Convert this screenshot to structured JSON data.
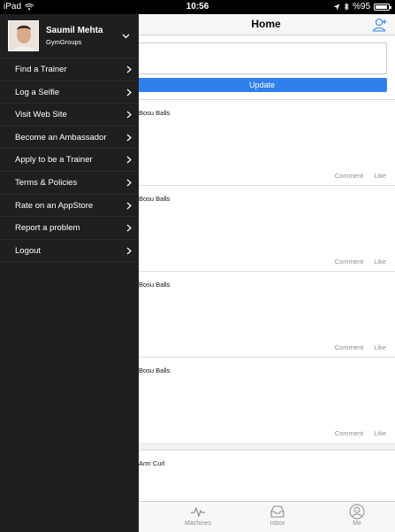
{
  "status": {
    "device": "iPad",
    "time": "10:56",
    "battery": "%95"
  },
  "nav": {
    "title": "Home"
  },
  "compose": {
    "update_label": "Update"
  },
  "posts": [
    {
      "title": "Bosu Balls",
      "comment": "Comment",
      "like": "Like"
    },
    {
      "title": "Bosu Balls",
      "comment": "Comment",
      "like": "Like"
    },
    {
      "title": "Bosu Balls",
      "comment": "Comment",
      "like": "Like"
    },
    {
      "title": "Bosu Balls",
      "comment": "Comment",
      "like": "Like"
    },
    {
      "title": "Arm Curl"
    }
  ],
  "tabs": [
    {
      "label": "Machines",
      "icon": "pulse-icon"
    },
    {
      "label": "Inbox",
      "icon": "inbox-icon"
    },
    {
      "label": "Me",
      "icon": "person-icon"
    }
  ],
  "drawer": {
    "profile": {
      "name": "Saumil Mehta",
      "subtitle": "GymGroups"
    },
    "items": [
      {
        "label": "Find a Trainer"
      },
      {
        "label": "Log a Selfie"
      },
      {
        "label": "Visit Web Site"
      },
      {
        "label": "Become an Ambassador"
      },
      {
        "label": "Apply to be a Trainer"
      },
      {
        "label": "Terms & Policies"
      },
      {
        "label": "Rate on an AppStore"
      },
      {
        "label": "Report a problem"
      },
      {
        "label": "Logout"
      }
    ]
  },
  "colors": {
    "accent": "#2f80ed",
    "drawer_bg": "#1f1f21"
  }
}
